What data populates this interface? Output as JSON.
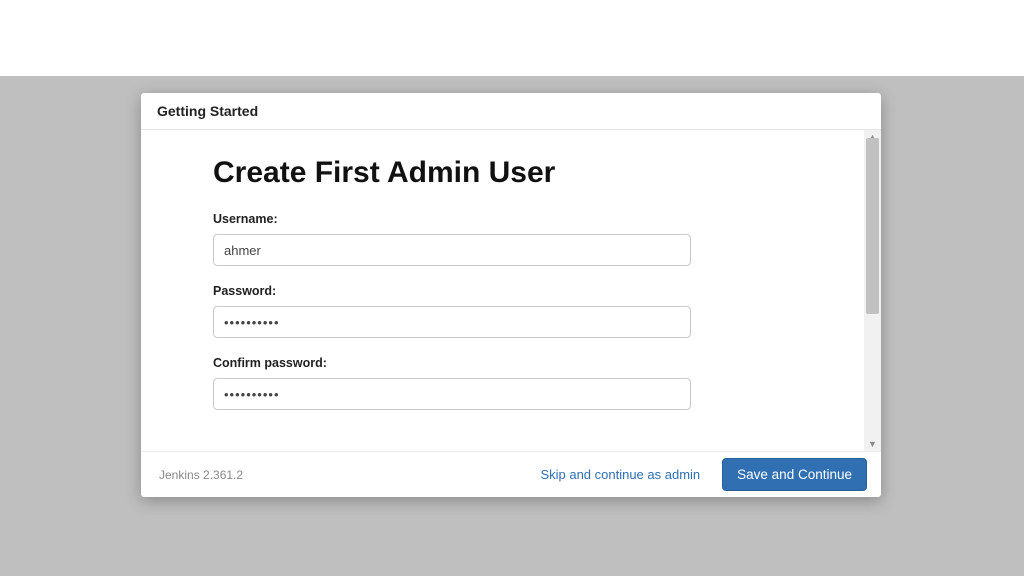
{
  "header": {
    "title": "Getting Started"
  },
  "page": {
    "heading": "Create First Admin User"
  },
  "form": {
    "username_label": "Username:",
    "username_value": "ahmer",
    "password_label": "Password:",
    "password_masked": "••••••••••",
    "confirm_label": "Confirm password:",
    "confirm_masked": "••••••••••"
  },
  "footer": {
    "version_text": "Jenkins 2.361.2",
    "skip_label": "Skip and continue as admin",
    "save_label": "Save and Continue"
  }
}
